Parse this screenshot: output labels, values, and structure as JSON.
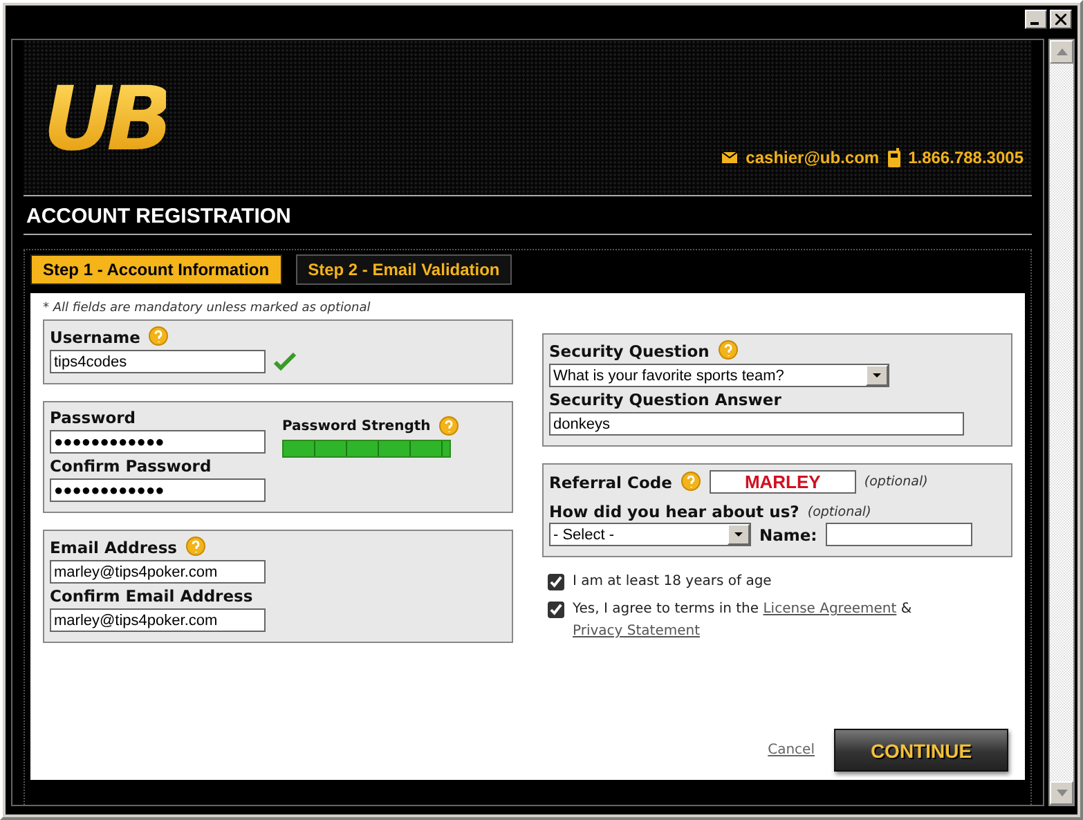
{
  "logo": {
    "text": "UB"
  },
  "contact": {
    "email": "cashier@ub.com",
    "phone": "1.866.788.3005"
  },
  "title": "ACCOUNT REGISTRATION",
  "tabs": [
    {
      "label": "Step 1 - Account Information",
      "selected": true
    },
    {
      "label": "Step 2 - Email Validation",
      "selected": false
    }
  ],
  "note": "* All fields are mandatory unless marked as optional",
  "username": {
    "label": "Username",
    "value": "tips4codes",
    "valid": true
  },
  "password": {
    "label": "Password",
    "value": "●●●●●●●●●●●●",
    "strength_label": "Password Strength",
    "level": 1,
    "confirm_label": "Confirm Password",
    "confirm_value": "●●●●●●●●●●●●"
  },
  "email": {
    "label": "Email Address",
    "value": "marley@tips4poker.com",
    "confirm_label": "Confirm Email Address",
    "confirm_value": "marley@tips4poker.com"
  },
  "security": {
    "label": "Security Question",
    "value": "What is your favorite sports team?",
    "answer_label": "Security Question Answer",
    "answer_value": "donkeys"
  },
  "referral": {
    "label": "Referral Code",
    "value": "MARLEY",
    "optional": "(optional)",
    "hear_label": "How did you hear about us?",
    "hear_optional": "(optional)",
    "hear_value": "- Select -",
    "name_label": "Name:"
  },
  "agreements": [
    {
      "text": "I am at least 18 years of age",
      "checked": true
    },
    {
      "text": "Yes, I agree to terms in the",
      "checked": true,
      "link": "License Agreement",
      "joiner": "&",
      "link2": "Privacy Statement"
    }
  ],
  "cancel": "Cancel",
  "continue": "CONTINUE"
}
